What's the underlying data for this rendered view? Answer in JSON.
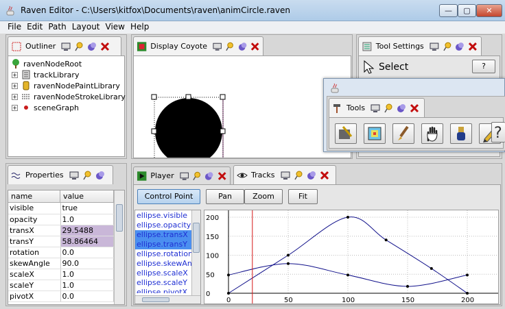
{
  "window": {
    "title": "Raven Editor - C:\\Users\\kitfox\\Documents\\raven\\animCircle.raven",
    "min": "—",
    "max": "▢",
    "close": "✕"
  },
  "menu": [
    "File",
    "Edit",
    "Path",
    "Layout",
    "View",
    "Help"
  ],
  "outliner": {
    "tab": "Outliner",
    "items": [
      {
        "label": "ravenNodeRoot",
        "level": 0
      },
      {
        "label": "trackLibrary",
        "level": 1
      },
      {
        "label": "ravenNodePaintLibrary",
        "level": 1
      },
      {
        "label": "ravenNodeStrokeLibrary",
        "level": 1
      },
      {
        "label": "sceneGraph",
        "level": 1
      }
    ]
  },
  "display": {
    "tab": "Display Coyote"
  },
  "toolSettings": {
    "tab": "Tool Settings",
    "select_label": "Select",
    "help_btn": "?"
  },
  "tools": {
    "tab": "Tools"
  },
  "properties": {
    "tab": "Properties",
    "headers": [
      "name",
      "value"
    ],
    "rows": [
      {
        "name": "visible",
        "value": "true"
      },
      {
        "name": "opacity",
        "value": "1.0"
      },
      {
        "name": "transX",
        "value": "29.5488"
      },
      {
        "name": "transY",
        "value": "58.86464"
      },
      {
        "name": "rotation",
        "value": "0.0"
      },
      {
        "name": "skewAngle",
        "value": "90.0"
      },
      {
        "name": "scaleX",
        "value": "1.0"
      },
      {
        "name": "scaleY",
        "value": "1.0"
      },
      {
        "name": "pivotX",
        "value": "0.0"
      }
    ]
  },
  "player": {
    "tab": "Player"
  },
  "tracks": {
    "tab": "Tracks",
    "buttons": [
      "Control Point",
      "Pan",
      "Zoom",
      "Fit"
    ],
    "items": [
      "ellipse.visible",
      "ellipse.opacity",
      "ellipse.transX",
      "ellipse.transY",
      "ellipse.rotation",
      "ellipse.skewAngle",
      "ellipse.scaleX",
      "ellipse.scaleY",
      "ellipse.pivotX"
    ],
    "selected": [
      2,
      3
    ]
  },
  "chart_data": {
    "type": "line",
    "xlim": [
      0,
      200
    ],
    "ylim": [
      0,
      200
    ],
    "xticks": [
      "0",
      "50",
      "100",
      "150",
      "200"
    ],
    "yticks": [
      "0",
      "50",
      "100",
      "150",
      "200"
    ],
    "current_frame": 20,
    "series": [
      {
        "color": "#10108a",
        "x": [
          0,
          50,
          100,
          150,
          200
        ],
        "y": [
          0,
          100,
          200,
          110,
          0
        ],
        "knots": [
          [
            0,
            0
          ],
          [
            50,
            100
          ],
          [
            100,
            200
          ],
          [
            132,
            140
          ],
          [
            170,
            65
          ],
          [
            200,
            0
          ]
        ]
      },
      {
        "color": "#10108a",
        "x": [
          0,
          50,
          100,
          150,
          200
        ],
        "y": [
          48,
          78,
          48,
          18,
          48
        ],
        "knots": [
          [
            0,
            48
          ],
          [
            50,
            78
          ],
          [
            100,
            48
          ],
          [
            150,
            18
          ],
          [
            200,
            48
          ]
        ]
      }
    ]
  }
}
